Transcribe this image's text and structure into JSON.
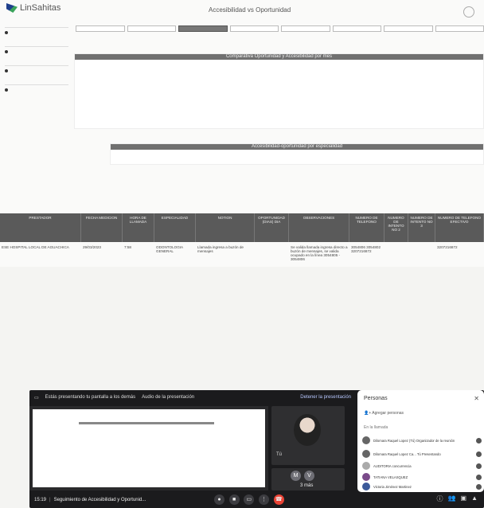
{
  "dashboard": {
    "logo_text": "LinSahitas",
    "title": "Accesibilidad vs Oportunidad",
    "chart1_title": "Comparativa Oportunidad y Accesibilidad por mes",
    "chart2_title": "Accesibilidad-oportunidad por especialidad",
    "table": {
      "headers": [
        "PRESTADOR",
        "FECHA MEDICION",
        "HORA DE LLAMADA",
        "ESPECIALIDAD",
        "NOTION",
        "OPORTUNIDAD (DIAS) DIA",
        "OBSERVACIONES",
        "NUMERO DE TELEFONO",
        "NUMERO DE INTENTO NO 2",
        "NUMERO DE INTENTO NO 3",
        "NUMERO DE TELEFONO EFECTIVO"
      ],
      "row": [
        "ESE HOSPITAL LOCAL DE AGUACHICA",
        "29/03/2023",
        "7:58",
        "ODONTOLOGIA GENERAL",
        "Llamada ingresa a buzón de mensajes",
        "",
        "Se valida llamada ingresa directo a buzón de mensajes, se valida ocupado en la línea 3054805 - 3054806",
        "3054806 3054802 3207216872",
        "",
        "",
        "3207216872"
      ]
    }
  },
  "meet": {
    "presenting_text": "Estás presentando tu pantalla a los demás",
    "audio_text": "Audio de la presentación",
    "stop_text": "Detener la presentación",
    "you_label": "Tú",
    "initials": [
      "M",
      "V"
    ],
    "more_label": "3 más",
    "time": "15:19",
    "meeting_title": "Seguimiento de Accesibilidad y Oportunid...",
    "people_panel": {
      "title": "Personas",
      "add_label": "Agregar personas",
      "section": "En la llamada",
      "people": [
        "Dilomara Raquel Lopez (Tú) Organizador de la reunión",
        "Dilomara Raquel Lopez Ca... Tú Presentando",
        "AUDITORIA concurrencia",
        "TATIANA VELASQUEZ",
        "Victoria Jiménez Martinez"
      ]
    }
  }
}
